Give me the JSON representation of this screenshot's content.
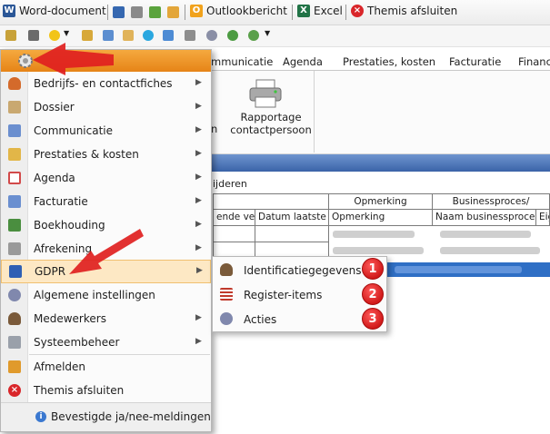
{
  "toolbar1": {
    "items": [
      {
        "label": "Word-document",
        "icon": "word-icon"
      },
      {
        "label": "Outlookbericht",
        "icon": "outlook-icon"
      },
      {
        "label": "Excel",
        "icon": "excel-icon"
      },
      {
        "label": "Themis afsluiten",
        "icon": "close-circle-icon"
      }
    ]
  },
  "tabs": [
    "mmunicatie",
    "Agenda",
    "Prestaties, kosten",
    "Facturatie",
    "Financ"
  ],
  "ribbon": {
    "button_line1": "Rapportage",
    "button_line2": "contactpersoon",
    "left_fragment": "n"
  },
  "panel": {
    "title_fragment": "ijderen",
    "group_headers": [
      "Opmerking",
      "Businessproces/"
    ],
    "columns": [
      "ende verv",
      "Datum laatste up",
      "Opmerking",
      "Naam businessproces",
      "Eig"
    ]
  },
  "menu": {
    "items": [
      {
        "label": "Bedrijfs- en contactfiches",
        "icon": "contact-person-icon",
        "submenu": true
      },
      {
        "label": "Dossier",
        "icon": "dossier-icon",
        "submenu": true
      },
      {
        "label": "Communicatie",
        "icon": "communication-icon",
        "submenu": true
      },
      {
        "label": "Prestaties & kosten",
        "icon": "performance-icon",
        "submenu": true
      },
      {
        "label": "Agenda",
        "icon": "calendar-icon",
        "submenu": true
      },
      {
        "label": "Facturatie",
        "icon": "invoice-icon",
        "submenu": true
      },
      {
        "label": "Boekhouding",
        "icon": "calculator-icon",
        "submenu": true
      },
      {
        "label": "Afrekening",
        "icon": "printer-icon",
        "submenu": true
      },
      {
        "label": "GDPR",
        "icon": "lock-icon",
        "submenu": true,
        "highlighted": true
      },
      {
        "label": "Algemene instellingen",
        "icon": "settings-gear-icon",
        "submenu": false
      },
      {
        "label": "Medewerkers",
        "icon": "employee-icon",
        "submenu": true
      },
      {
        "label": "Systeembeheer",
        "icon": "wrench-icon",
        "submenu": true
      },
      {
        "label": "Afmelden",
        "icon": "logout-icon",
        "submenu": false
      },
      {
        "label": "Themis afsluiten",
        "icon": "close-circle-icon",
        "submenu": false
      }
    ],
    "footer": "Bevestigde ja/nee-meldingen"
  },
  "submenu": {
    "items": [
      {
        "label": "Identificatiegegevens",
        "icon": "identity-icon",
        "badge": "1"
      },
      {
        "label": "Register-items",
        "icon": "list-icon",
        "badge": "2"
      },
      {
        "label": "Acties",
        "icon": "actions-gear-icon",
        "badge": "3"
      }
    ]
  },
  "colors": {
    "menu_header": "#e68417",
    "highlight": "#fde8c4",
    "badge": "#d11a1a",
    "annotation_arrow": "#e0201f",
    "blue_band": "#3a63a8",
    "selected_row": "#2f6fc5"
  }
}
